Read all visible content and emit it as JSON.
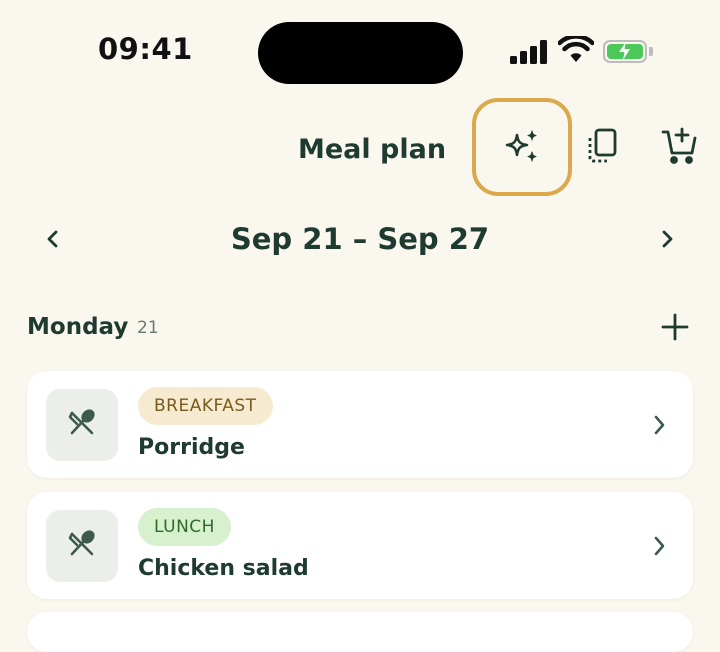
{
  "status_bar": {
    "time": "09:41"
  },
  "header": {
    "title": "Meal plan",
    "icons": [
      "sparkles-icon",
      "copy-icon",
      "add-to-cart-icon"
    ],
    "highlight_color": "#dba84b"
  },
  "week": {
    "range": "Sep 21 – Sep 27"
  },
  "day": {
    "name": "Monday",
    "date": "21"
  },
  "meals": [
    {
      "type": "BREAKFAST",
      "name": "Porridge",
      "icon": "utensils-icon"
    },
    {
      "type": "LUNCH",
      "name": "Chicken salad",
      "icon": "utensils-icon"
    }
  ],
  "colors": {
    "background": "#faf7ee",
    "text": "#1f3a31",
    "breakfast_badge": "#f6ebd0",
    "lunch_badge": "#d7f1cf"
  }
}
